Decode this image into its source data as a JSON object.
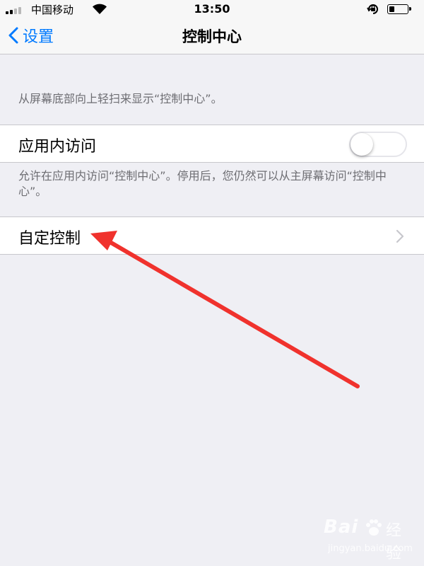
{
  "status_bar": {
    "carrier": "中国移动",
    "time": "13:50",
    "battery_level": 0.3,
    "signal_bars": 2
  },
  "nav": {
    "back_label": "设置",
    "title": "控制中心"
  },
  "section1": {
    "footer": "从屏幕底部向上轻扫来显示“控制中心”。"
  },
  "access_row": {
    "label": "应用内访问",
    "toggle_on": false
  },
  "section2": {
    "footer": "允许在应用内访问“控制中心”。停用后，您仍然可以从主屏幕访问“控制中心”。"
  },
  "customize_row": {
    "label": "自定控制"
  },
  "colors": {
    "accent": "#007aff",
    "background": "#efeff4",
    "annotation_arrow": "#f0322d"
  },
  "watermark": {
    "logo": "Bai",
    "name": "经验",
    "url": "jingyan.baidu.com"
  },
  "icons": [
    "signal-icon",
    "wifi-icon",
    "rotation-lock-icon",
    "battery-icon",
    "chevron-left-icon",
    "chevron-right-icon",
    "annotation-arrow-icon"
  ]
}
